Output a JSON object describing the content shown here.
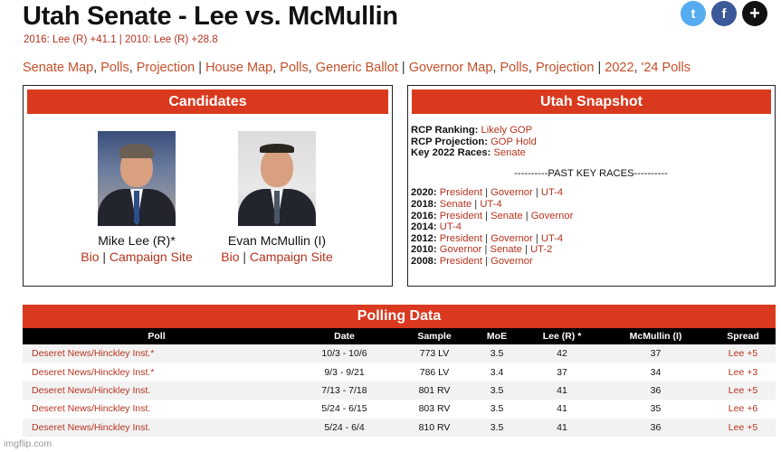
{
  "header": {
    "title": "Utah Senate - Lee vs. McMullin",
    "subtitle": "2016: Lee (R) +41.1 | 2010: Lee (R) +28.8"
  },
  "social": {
    "twitter_glyph": "t",
    "facebook_glyph": "f",
    "plus_glyph": "+"
  },
  "nav": [
    {
      "text": "Senate Map",
      "sep": ", "
    },
    {
      "text": "Polls",
      "sep": ", "
    },
    {
      "text": "Projection",
      "sep": " | "
    },
    {
      "text": "House Map",
      "sep": ", "
    },
    {
      "text": "Polls",
      "sep": ", "
    },
    {
      "text": "Generic Ballot",
      "sep": " | "
    },
    {
      "text": "Governor Map",
      "sep": ", "
    },
    {
      "text": "Polls",
      "sep": ", "
    },
    {
      "text": "Projection",
      "sep": " | "
    },
    {
      "text": "2022",
      "sep": ", "
    },
    {
      "text": "'24 Polls",
      "sep": ""
    }
  ],
  "candidates": {
    "heading": "Candidates",
    "lee": {
      "name": "Mike Lee (R)*",
      "bio": "Bio",
      "sep": " | ",
      "site": "Campaign Site"
    },
    "mcmullin": {
      "name": "Evan McMullin (I)",
      "bio": "Bio",
      "sep": " | ",
      "site": "Campaign Site"
    }
  },
  "snapshot": {
    "heading": "Utah Snapshot",
    "ranking_label": "RCP Ranking:",
    "ranking_value": "Likely GOP",
    "projection_label": "RCP Projection:",
    "projection_value": "GOP Hold",
    "key_label": "Key 2022 Races:",
    "key_value": "Senate",
    "past_label": "----------PAST KEY RACES----------",
    "past": [
      {
        "year": "2020:",
        "races": [
          "President",
          "Governor",
          "UT-4"
        ]
      },
      {
        "year": "2018:",
        "races": [
          "Senate",
          "UT-4"
        ]
      },
      {
        "year": "2016:",
        "races": [
          "President",
          "Senate",
          "Governor"
        ]
      },
      {
        "year": "2014:",
        "races": [
          "UT-4"
        ]
      },
      {
        "year": "2012:",
        "races": [
          "President",
          "Governor",
          "UT-4"
        ]
      },
      {
        "year": "2010:",
        "races": [
          "Governor",
          "Senate",
          "UT-2"
        ]
      },
      {
        "year": "2008:",
        "races": [
          "President",
          "Governor"
        ]
      }
    ]
  },
  "polling": {
    "heading": "Polling Data",
    "columns": [
      "Poll",
      "Date",
      "Sample",
      "MoE",
      "Lee (R) *",
      "McMullin (I)",
      "Spread"
    ],
    "rows": [
      [
        "Deseret News/Hinckley Inst.*",
        "10/3 - 10/6",
        "773 LV",
        "3.5",
        "42",
        "37",
        "Lee +5"
      ],
      [
        "Deseret News/Hinckley Inst.*",
        "9/3 - 9/21",
        "786 LV",
        "3.4",
        "37",
        "34",
        "Lee +3"
      ],
      [
        "Deseret News/Hinckley Inst.",
        "7/13 - 7/18",
        "801 RV",
        "3.5",
        "41",
        "36",
        "Lee +5"
      ],
      [
        "Deseret News/Hinckley Inst.",
        "5/24 - 6/15",
        "803 RV",
        "3.5",
        "41",
        "35",
        "Lee +6"
      ],
      [
        "Deseret News/Hinckley Inst.",
        "5/24 - 6/4",
        "810 RV",
        "3.5",
        "41",
        "36",
        "Lee +5"
      ]
    ]
  },
  "watermark": "imgflip.com",
  "colors": {
    "accent": "#d9391e",
    "link": "#b5331f",
    "twitter": "#55acee",
    "facebook": "#3b5998"
  }
}
